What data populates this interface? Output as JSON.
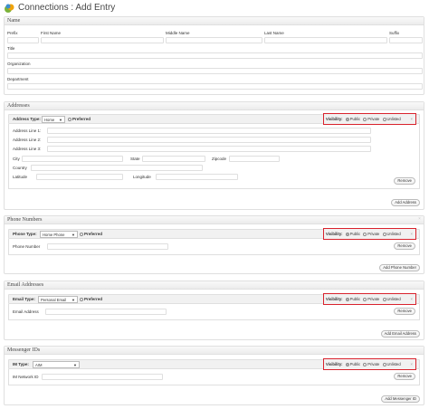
{
  "page": {
    "title": "Connections : Add Entry"
  },
  "name_section": {
    "heading": "Name",
    "prefix_label": "Prefix",
    "first_name_label": "First Name",
    "middle_name_label": "Middle Name",
    "last_name_label": "Last Name",
    "suffix_label": "Suffix",
    "title_label": "Title",
    "organization_label": "Organization",
    "department_label": "Department"
  },
  "addresses": {
    "heading": "Addresses",
    "type_label": "Address Type:",
    "type_value": "Home",
    "preferred_label": "Preferred",
    "visibility_label": "Visibility:",
    "visibility_options": [
      "Public",
      "Private",
      "Unlisted"
    ],
    "visibility_selected": "Public",
    "line1_label": "Address Line 1:",
    "line2_label": "Address Line 2:",
    "line3_label": "Address Line 3:",
    "city_label": "City",
    "state_label": "State",
    "zipcode_label": "Zipcode",
    "country_label": "Country",
    "latitude_label": "Latitude",
    "longitude_label": "Longitude",
    "remove_label": "Remove",
    "add_label": "Add Address"
  },
  "phones": {
    "heading": "Phone Numbers",
    "type_label": "Phone Type:",
    "type_value": "Home Phone",
    "preferred_label": "Preferred",
    "visibility_label": "Visibility:",
    "visibility_options": [
      "Public",
      "Private",
      "Unlisted"
    ],
    "visibility_selected": "Public",
    "field_label": "Phone Number",
    "remove_label": "Remove",
    "add_label": "Add Phone Number"
  },
  "emails": {
    "heading": "Email Addresses",
    "type_label": "Email Type:",
    "type_value": "Personal Email",
    "preferred_label": "Preferred",
    "visibility_label": "Visibility:",
    "visibility_options": [
      "Public",
      "Private",
      "Unlisted"
    ],
    "visibility_selected": "Public",
    "field_label": "Email Address",
    "remove_label": "Remove",
    "add_label": "Add Email Address"
  },
  "messengers": {
    "heading": "Messenger IDs",
    "type_label": "IM Type:",
    "type_value": "AIM",
    "visibility_label": "Visibility:",
    "visibility_options": [
      "Public",
      "Private",
      "Unlisted"
    ],
    "visibility_selected": "Public",
    "field_label": "IM Network ID",
    "remove_label": "Remove",
    "add_label": "Add Messenger ID"
  },
  "icons": {
    "logo": "connections-logo-icon",
    "close": "close-icon",
    "dropdown": "chevron-down-icon"
  },
  "colors": {
    "highlight": "#d9232d",
    "panel_border": "#dfdfdf",
    "header_bg": "#ececec"
  }
}
